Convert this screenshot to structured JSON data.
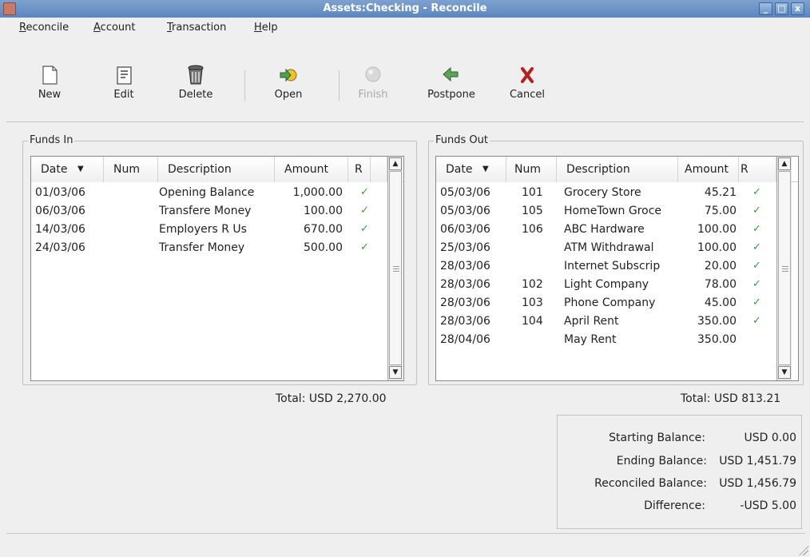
{
  "window": {
    "title": "Assets:Checking - Reconcile",
    "controls": [
      "_",
      "□",
      "x"
    ]
  },
  "menu": {
    "items": [
      {
        "label": "Reconcile",
        "mnemonic": "R"
      },
      {
        "label": "Account",
        "mnemonic": "A"
      },
      {
        "label": "Transaction",
        "mnemonic": "T"
      },
      {
        "label": "Help",
        "mnemonic": "H"
      }
    ]
  },
  "toolbar": {
    "new": "New",
    "edit": "Edit",
    "delete": "Delete",
    "open": "Open",
    "finish": "Finish",
    "postpone": "Postpone",
    "cancel": "Cancel"
  },
  "funds_in": {
    "label": "Funds In",
    "columns": {
      "date": "Date",
      "num": "Num",
      "description": "Description",
      "amount": "Amount",
      "r": "R"
    },
    "rows": [
      {
        "date": "01/03/06",
        "num": "",
        "description": "Opening Balance",
        "amount": "1,000.00",
        "r": "✓"
      },
      {
        "date": "06/03/06",
        "num": "",
        "description": "Transfere Money",
        "amount": "100.00",
        "r": "✓"
      },
      {
        "date": "14/03/06",
        "num": "",
        "description": "Employers R Us",
        "amount": "670.00",
        "r": "✓"
      },
      {
        "date": "24/03/06",
        "num": "",
        "description": "Transfer Money",
        "amount": "500.00",
        "r": "✓"
      }
    ],
    "total": "Total: USD 2,270.00"
  },
  "funds_out": {
    "label": "Funds Out",
    "columns": {
      "date": "Date",
      "num": "Num",
      "description": "Description",
      "amount": "Amount",
      "r": "R"
    },
    "rows": [
      {
        "date": "05/03/06",
        "num": "101",
        "description": "Grocery Store",
        "amount": "45.21",
        "r": "✓"
      },
      {
        "date": "05/03/06",
        "num": "105",
        "description": "HomeTown Groce",
        "amount": "75.00",
        "r": "✓"
      },
      {
        "date": "06/03/06",
        "num": "106",
        "description": "ABC Hardware",
        "amount": "100.00",
        "r": "✓"
      },
      {
        "date": "25/03/06",
        "num": "",
        "description": "ATM Withdrawal",
        "amount": "100.00",
        "r": "✓"
      },
      {
        "date": "28/03/06",
        "num": "",
        "description": "Internet Subscrip",
        "amount": "20.00",
        "r": "✓"
      },
      {
        "date": "28/03/06",
        "num": "102",
        "description": "Light Company",
        "amount": "78.00",
        "r": "✓"
      },
      {
        "date": "28/03/06",
        "num": "103",
        "description": "Phone Company",
        "amount": "45.00",
        "r": "✓"
      },
      {
        "date": "28/03/06",
        "num": "104",
        "description": "April Rent",
        "amount": "350.00",
        "r": "✓"
      },
      {
        "date": "28/04/06",
        "num": "",
        "description": "May Rent",
        "amount": "350.00",
        "r": ""
      }
    ],
    "total": "Total: USD 813.21"
  },
  "summary": {
    "starting_label": "Starting Balance:",
    "starting_value": "USD 0.00",
    "ending_label": "Ending Balance:",
    "ending_value": "USD 1,451.79",
    "reconciled_label": "Reconciled Balance:",
    "reconciled_value": "USD 1,456.79",
    "difference_label": "Difference:",
    "difference_value": "-USD 5.00"
  }
}
